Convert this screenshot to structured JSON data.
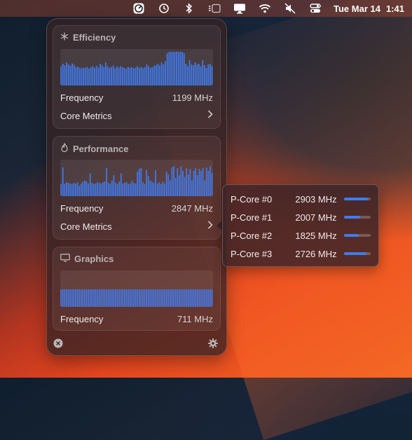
{
  "menubar": {
    "date": "Tue Mar 14",
    "time": "1:41",
    "icons": [
      "stats-gauge-icon",
      "time-machine-icon",
      "bluetooth-icon",
      "stage-manager-icon",
      "display-icon",
      "wifi-icon",
      "mute-icon",
      "control-center-icon"
    ]
  },
  "efficiency": {
    "title": "Efficiency",
    "icon": "snowflake-icon",
    "frequency_label": "Frequency",
    "frequency_value": "1199 MHz",
    "core_metrics_label": "Core Metrics",
    "history": [
      0.55,
      0.62,
      0.58,
      0.66,
      0.6,
      0.56,
      0.63,
      0.59,
      0.52,
      0.54,
      0.5,
      0.49,
      0.51,
      0.5,
      0.53,
      0.48,
      0.52,
      0.55,
      0.5,
      0.56,
      0.51,
      0.62,
      0.58,
      0.52,
      0.66,
      0.55,
      0.5,
      0.53,
      0.57,
      0.49,
      0.54,
      0.51,
      0.55,
      0.52,
      0.5,
      0.48,
      0.53,
      0.5,
      0.52,
      0.49,
      0.51,
      0.55,
      0.5,
      0.53,
      0.49,
      0.52,
      0.6,
      0.55,
      0.5,
      0.52,
      0.56,
      0.58,
      0.62,
      0.57,
      0.66,
      0.6,
      0.7,
      0.92,
      0.96,
      0.96,
      0.96,
      0.96,
      0.96,
      0.96,
      0.96,
      0.96,
      0.92,
      0.62,
      0.55,
      0.72,
      0.6,
      0.58,
      0.66,
      0.6,
      0.62,
      0.55,
      0.72,
      0.58,
      0.5,
      0.6,
      0.62,
      0.55
    ]
  },
  "performance": {
    "title": "Performance",
    "icon": "flame-icon",
    "frequency_label": "Frequency",
    "frequency_value": "2847 MHz",
    "core_metrics_label": "Core Metrics",
    "history": [
      0.35,
      0.82,
      0.35,
      0.4,
      0.38,
      0.36,
      0.34,
      0.38,
      0.36,
      0.4,
      0.3,
      0.36,
      0.42,
      0.45,
      0.42,
      0.36,
      0.65,
      0.38,
      0.35,
      0.36,
      0.4,
      0.38,
      0.36,
      0.4,
      0.42,
      0.8,
      0.38,
      0.36,
      0.44,
      0.6,
      0.38,
      0.35,
      0.42,
      0.65,
      0.36,
      0.38,
      0.4,
      0.35,
      0.36,
      0.44,
      0.38,
      0.36,
      0.7,
      0.78,
      0.8,
      0.4,
      0.35,
      0.75,
      0.58,
      0.44,
      0.42,
      0.38,
      0.74,
      0.36,
      0.4,
      0.35,
      0.42,
      0.36,
      0.7,
      0.62,
      0.45,
      0.82,
      0.86,
      0.52,
      0.8,
      0.6,
      0.86,
      0.72,
      0.55,
      0.8,
      0.62,
      0.78,
      0.45,
      0.72,
      0.8,
      0.6,
      0.78,
      0.72,
      0.8,
      0.45,
      0.82,
      0.72,
      0.85,
      0.66
    ]
  },
  "graphics": {
    "title": "Graphics",
    "icon": "display-icon",
    "frequency_label": "Frequency",
    "frequency_value": "711 MHz",
    "history_level": 0.5
  },
  "footer": {
    "close_icon": "close-icon",
    "settings_icon": "gear-icon"
  },
  "pcores": [
    {
      "name": "P-Core #0",
      "freq": "2903 MHz",
      "load": 0.9
    },
    {
      "name": "P-Core #1",
      "freq": "2007 MHz",
      "load": 0.6
    },
    {
      "name": "P-Core #2",
      "freq": "1825 MHz",
      "load": 0.55
    },
    {
      "name": "P-Core #3",
      "freq": "2726 MHz",
      "load": 0.85
    }
  ],
  "colors": {
    "bar": "#3f7bf0",
    "panel": "#362224"
  }
}
